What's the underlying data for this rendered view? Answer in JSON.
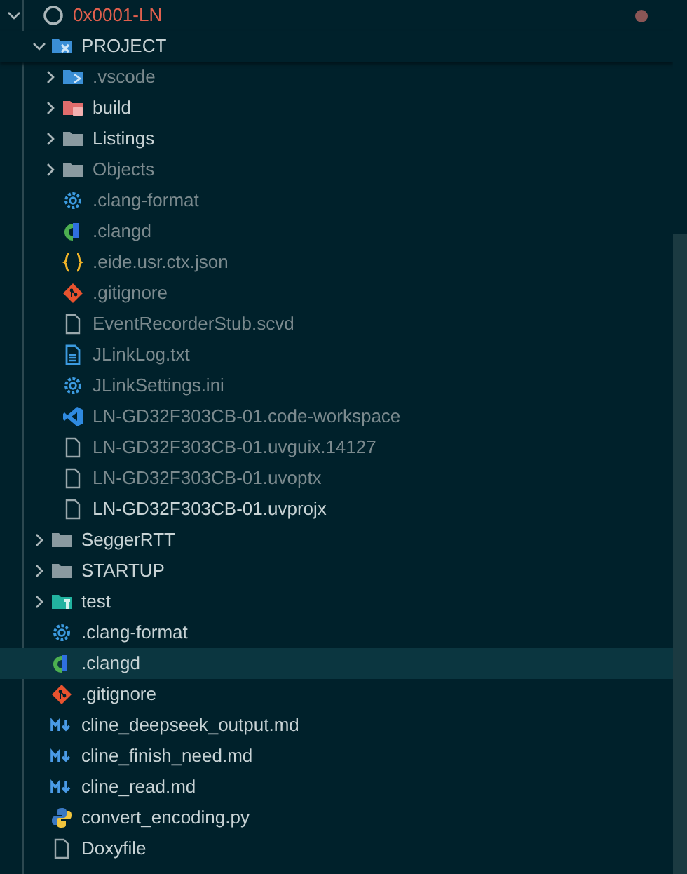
{
  "tree": {
    "label": "0x0001-LN",
    "expanded": true,
    "modified": true,
    "selected": false,
    "children": [
      {
        "label": "PROJECT",
        "kind": "project-folder",
        "expanded": true,
        "dimmed": false,
        "selected": false,
        "children": [
          {
            "label": ".vscode",
            "kind": "vscode-folder",
            "expanded": false,
            "dimmed": true,
            "selected": false
          },
          {
            "label": "build",
            "kind": "build-folder",
            "expanded": false,
            "dimmed": false,
            "selected": false
          },
          {
            "label": "Listings",
            "kind": "folder",
            "expanded": false,
            "dimmed": false,
            "selected": false
          },
          {
            "label": "Objects",
            "kind": "folder",
            "expanded": false,
            "dimmed": true,
            "selected": false
          },
          {
            "label": ".clang-format",
            "kind": "gear",
            "dimmed": true,
            "selected": false
          },
          {
            "label": ".clangd",
            "kind": "clangd",
            "dimmed": true,
            "selected": false
          },
          {
            "label": ".eide.usr.ctx.json",
            "kind": "json",
            "dimmed": true,
            "selected": false
          },
          {
            "label": ".gitignore",
            "kind": "git",
            "dimmed": true,
            "selected": false
          },
          {
            "label": "EventRecorderStub.scvd",
            "kind": "file",
            "dimmed": true,
            "selected": false
          },
          {
            "label": "JLinkLog.txt",
            "kind": "text",
            "dimmed": true,
            "selected": false
          },
          {
            "label": "JLinkSettings.ini",
            "kind": "gear",
            "dimmed": true,
            "selected": false
          },
          {
            "label": "LN-GD32F303CB-01.code-workspace",
            "kind": "vscode",
            "dimmed": true,
            "selected": false
          },
          {
            "label": "LN-GD32F303CB-01.uvguix.14127",
            "kind": "file",
            "dimmed": true,
            "selected": false
          },
          {
            "label": "LN-GD32F303CB-01.uvoptx",
            "kind": "file",
            "dimmed": true,
            "selected": false
          },
          {
            "label": "LN-GD32F303CB-01.uvprojx",
            "kind": "file",
            "dimmed": false,
            "selected": false
          }
        ]
      },
      {
        "label": "SeggerRTT",
        "kind": "folder",
        "expanded": false,
        "dimmed": false,
        "selected": false
      },
      {
        "label": "STARTUP",
        "kind": "folder",
        "expanded": false,
        "dimmed": false,
        "selected": false
      },
      {
        "label": "test",
        "kind": "test-folder",
        "expanded": false,
        "dimmed": false,
        "selected": false
      },
      {
        "label": ".clang-format",
        "kind": "gear",
        "dimmed": false,
        "selected": false
      },
      {
        "label": ".clangd",
        "kind": "clangd",
        "dimmed": false,
        "selected": true
      },
      {
        "label": ".gitignore",
        "kind": "git",
        "dimmed": false,
        "selected": false
      },
      {
        "label": "cline_deepseek_output.md",
        "kind": "markdown",
        "dimmed": false,
        "selected": false
      },
      {
        "label": "cline_finish_need.md",
        "kind": "markdown",
        "dimmed": false,
        "selected": false
      },
      {
        "label": "cline_read.md",
        "kind": "markdown",
        "dimmed": false,
        "selected": false
      },
      {
        "label": "convert_encoding.py",
        "kind": "python",
        "dimmed": false,
        "selected": false
      },
      {
        "label": "Doxyfile",
        "kind": "file",
        "dimmed": false,
        "selected": false
      }
    ]
  }
}
